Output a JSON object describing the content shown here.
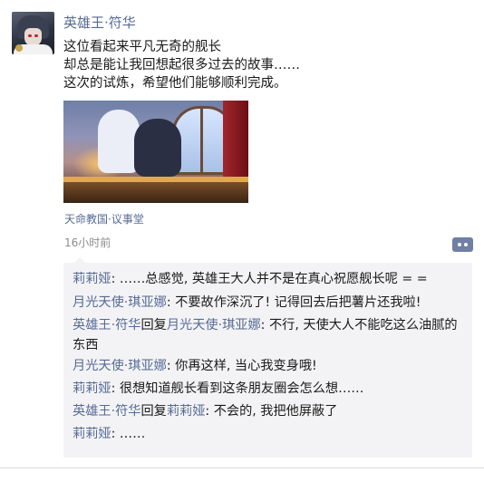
{
  "post": {
    "author": "英雄王·符华",
    "lines": [
      "这位看起来平凡无奇的舰长",
      "却总是能让我回想起很多过去的故事……",
      "这次的试炼，希望他们能够顺利完成。"
    ],
    "location": "天命教国·议事堂",
    "time": "16小时前"
  },
  "comments": [
    {
      "user": "莉莉娅",
      "reply_word": "",
      "reply_to": "",
      "sep": ": ",
      "text": "……总感觉, 英雄王大人并不是在真心祝愿舰长呢 = ="
    },
    {
      "user": "月光天使·琪亚娜",
      "reply_word": "",
      "reply_to": "",
      "sep": ": ",
      "text": "不要故作深沉了! 记得回去后把薯片还我啦!"
    },
    {
      "user": "英雄王·符华",
      "reply_word": "回复",
      "reply_to": "月光天使·琪亚娜",
      "sep": ": ",
      "text": "不行, 天使大人不能吃这么油腻的东西"
    },
    {
      "user": "月光天使·琪亚娜",
      "reply_word": "",
      "reply_to": "",
      "sep": ": ",
      "text": "你再这样, 当心我变身哦!"
    },
    {
      "user": "莉莉娅",
      "reply_word": "",
      "reply_to": "",
      "sep": ": ",
      "text": "很想知道舰长看到这条朋友圈会怎么想……"
    },
    {
      "user": "英雄王·符华",
      "reply_word": "回复",
      "reply_to": "莉莉娅",
      "sep": ": ",
      "text": "不会的, 我把他屏蔽了"
    },
    {
      "user": "莉莉娅",
      "reply_word": "",
      "reply_to": "",
      "sep": ": ",
      "text": "……"
    }
  ],
  "colors": {
    "link": "#576b95",
    "comment_bg": "#f3f3f5",
    "time": "#8c8c8c",
    "more_button": "#6f7fa6"
  },
  "icons": {
    "avatar": "avatar-image",
    "more": "more-dots-icon"
  }
}
